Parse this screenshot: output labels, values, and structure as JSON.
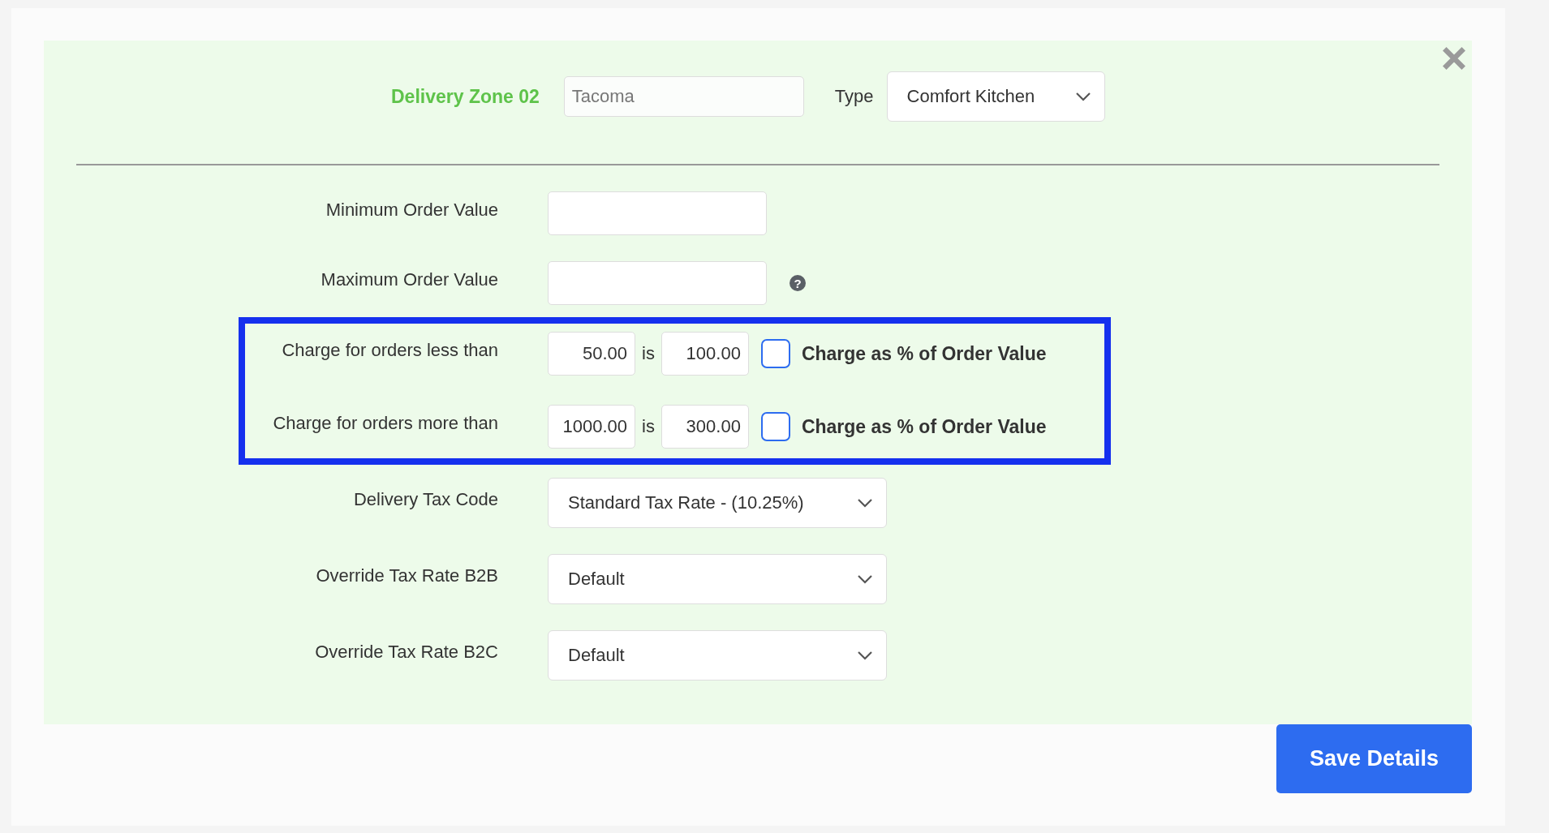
{
  "header": {
    "zone_label": "Delivery Zone 02",
    "zone_name": "Tacoma",
    "type_label": "Type",
    "type_value": "Comfort Kitchen"
  },
  "fields": [
    {
      "label": "Minimum Order Value"
    },
    {
      "label": "Maximum Order Value",
      "help": "?"
    }
  ],
  "charges": [
    {
      "label": "Charge for orders less than",
      "threshold": "50.00",
      "is": "is",
      "charge": "100.00",
      "percent_label": "Charge as % of Order Value",
      "checked": false
    },
    {
      "label": "Charge for orders more than",
      "threshold": "1000.00",
      "is": "is",
      "charge": "300.00",
      "percent_label": "Charge as % of Order Value",
      "checked": false
    }
  ],
  "tax_selects": [
    {
      "label": "Delivery Tax Code",
      "value": "Standard Tax Rate - (10.25%)"
    },
    {
      "label": "Override Tax Rate B2B",
      "value": "Default"
    },
    {
      "label": "Override Tax Rate B2C",
      "value": "Default"
    }
  ],
  "save_button": "Save Details"
}
